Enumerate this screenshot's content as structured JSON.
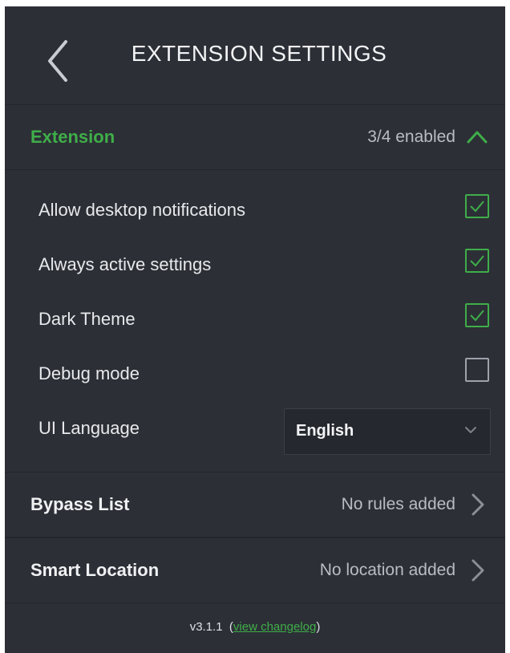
{
  "header": {
    "title": "EXTENSION SETTINGS"
  },
  "sections": {
    "extension": {
      "title": "Extension",
      "summary": "3/4 enabled",
      "expanded": true
    },
    "bypass": {
      "title": "Bypass List",
      "summary": "No rules added"
    },
    "smart_location": {
      "title": "Smart Location",
      "summary": "No location added"
    }
  },
  "settings": [
    {
      "label": "Allow desktop notifications",
      "checked": true
    },
    {
      "label": "Always active settings",
      "checked": true
    },
    {
      "label": "Dark Theme",
      "checked": true
    },
    {
      "label": "Debug mode",
      "checked": false
    }
  ],
  "language": {
    "label": "UI Language",
    "value": "English"
  },
  "footer": {
    "version": "v3.1.1",
    "open_paren": "(",
    "link_text": "view changelog",
    "close_paren": ")"
  },
  "colors": {
    "background": "#2c2f36",
    "accent_green": "#3fae49",
    "text": "#e8e9ec",
    "muted_text": "#b9bcc3"
  },
  "icons": {
    "back": "chevron-left-icon",
    "collapse": "chevron-up-icon",
    "section_arrow": "chevron-right-icon",
    "dropdown": "chevron-down-icon",
    "checked": "checkmark-icon"
  }
}
